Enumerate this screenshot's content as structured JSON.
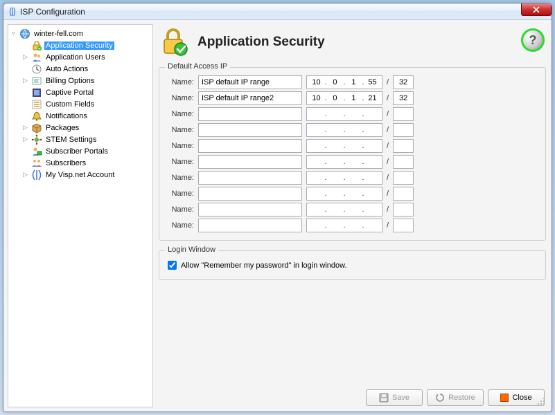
{
  "window": {
    "title": "ISP Configuration"
  },
  "tree": {
    "root": {
      "label": "winter-fell.com",
      "icon": "globe"
    },
    "items": [
      {
        "label": "Application Security",
        "icon": "lock-green",
        "indent": 1,
        "selected": true,
        "expand": ""
      },
      {
        "label": "Application Users",
        "icon": "users",
        "indent": 1,
        "expand": "▷"
      },
      {
        "label": "Auto Actions",
        "icon": "clock",
        "indent": 1,
        "expand": ""
      },
      {
        "label": "Billing Options",
        "icon": "billing",
        "indent": 1,
        "expand": "▷"
      },
      {
        "label": "Captive Portal",
        "icon": "portal",
        "indent": 1,
        "expand": ""
      },
      {
        "label": "Custom Fields",
        "icon": "fields",
        "indent": 1,
        "expand": ""
      },
      {
        "label": "Notifications",
        "icon": "bell",
        "indent": 1,
        "expand": ""
      },
      {
        "label": "Packages",
        "icon": "package",
        "indent": 1,
        "expand": "▷"
      },
      {
        "label": "STEM Settings",
        "icon": "stem",
        "indent": 1,
        "expand": "▷"
      },
      {
        "label": "Subscriber Portals",
        "icon": "sub-portal",
        "indent": 1,
        "expand": ""
      },
      {
        "label": "Subscribers",
        "icon": "subscribers",
        "indent": 1,
        "expand": ""
      },
      {
        "label": "My Visp.net Account",
        "icon": "visp",
        "indent": 1,
        "expand": "▷"
      }
    ]
  },
  "page": {
    "title": "Application Security",
    "default_access_group": "Default Access IP",
    "name_label": "Name:",
    "slash": "/",
    "rows": [
      {
        "name": "ISP default IP range",
        "o1": "10",
        "o2": "0",
        "o3": "1",
        "o4": "55",
        "mask": "32"
      },
      {
        "name": "ISP default IP range2",
        "o1": "10",
        "o2": "0",
        "o3": "1",
        "o4": "21",
        "mask": "32"
      },
      {
        "name": "",
        "o1": "",
        "o2": "",
        "o3": "",
        "o4": "",
        "mask": ""
      },
      {
        "name": "",
        "o1": "",
        "o2": "",
        "o3": "",
        "o4": "",
        "mask": ""
      },
      {
        "name": "",
        "o1": "",
        "o2": "",
        "o3": "",
        "o4": "",
        "mask": ""
      },
      {
        "name": "",
        "o1": "",
        "o2": "",
        "o3": "",
        "o4": "",
        "mask": ""
      },
      {
        "name": "",
        "o1": "",
        "o2": "",
        "o3": "",
        "o4": "",
        "mask": ""
      },
      {
        "name": "",
        "o1": "",
        "o2": "",
        "o3": "",
        "o4": "",
        "mask": ""
      },
      {
        "name": "",
        "o1": "",
        "o2": "",
        "o3": "",
        "o4": "",
        "mask": ""
      },
      {
        "name": "",
        "o1": "",
        "o2": "",
        "o3": "",
        "o4": "",
        "mask": ""
      }
    ],
    "login_group": "Login Window",
    "login_checkbox_label": "Allow \"Remember my password\" in login window.",
    "login_checked": true
  },
  "buttons": {
    "save": "Save",
    "restore": "Restore",
    "close": "Close"
  }
}
